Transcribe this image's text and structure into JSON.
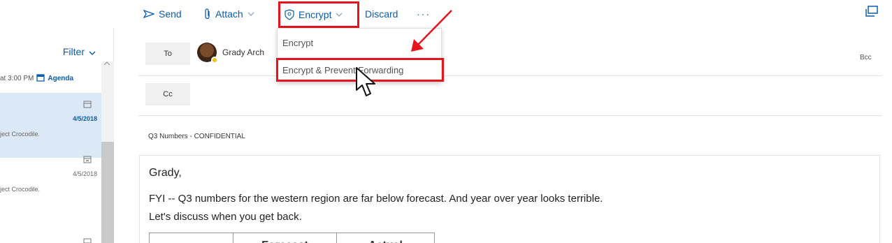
{
  "toolbar": {
    "send_label": "Send",
    "attach_label": "Attach",
    "encrypt_label": "Encrypt",
    "discard_label": "Discard",
    "more_label": "···"
  },
  "list": {
    "filter_label": "Filter",
    "agenda_time": "at 3:00 PM",
    "agenda_label": "Agenda",
    "items": [
      {
        "date": "4/5/2018",
        "snippet": "ject Crocodile."
      },
      {
        "date": "4/5/2018",
        "snippet": "ject Crocodile."
      }
    ]
  },
  "compose": {
    "to_label": "To",
    "cc_label": "Cc",
    "bcc_label": "Bcc",
    "recipient_name": "Grady Arch",
    "subject": "Q3 Numbers - CONFIDENTIAL",
    "greeting": "Grady,",
    "line1": "FYI -- Q3 numbers for the western region are far below forecast. And year over year looks terrible.",
    "line2": "Let's discuss when you get back.",
    "table_headers": [
      "",
      "Forecast",
      "Actual"
    ]
  },
  "encrypt_menu": {
    "items": [
      "Encrypt",
      "Encrypt & Prevent Forwarding"
    ]
  },
  "colors": {
    "accent": "#0b5cad",
    "highlight": "#e8131b",
    "selected_row": "#dbe9f7"
  }
}
